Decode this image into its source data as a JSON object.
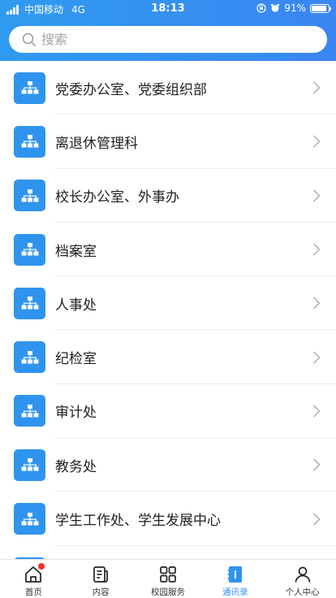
{
  "status_bar": {
    "carrier": "中国移动",
    "network": "4G",
    "time": "18:13",
    "battery": "91%",
    "battery_level": 0.91
  },
  "search": {
    "placeholder": "搜索"
  },
  "departments": [
    {
      "label": "党委办公室、党委组织部"
    },
    {
      "label": "离退休管理科"
    },
    {
      "label": "校长办公室、外事办"
    },
    {
      "label": "档案室"
    },
    {
      "label": "人事处"
    },
    {
      "label": "纪检室"
    },
    {
      "label": "审计处"
    },
    {
      "label": "教务处"
    },
    {
      "label": "学生工作处、学生发展中心"
    }
  ],
  "tabbar": {
    "items": [
      {
        "label": "首页",
        "icon": "home-icon",
        "badge": true
      },
      {
        "label": "内容",
        "icon": "content-icon"
      },
      {
        "label": "校园服务",
        "icon": "grid-icon"
      },
      {
        "label": "通讯录",
        "icon": "contacts-icon",
        "active": true
      },
      {
        "label": "个人中心",
        "icon": "person-icon"
      }
    ]
  },
  "colors": {
    "accent": "#2f94ee",
    "badge": "#f23030"
  }
}
